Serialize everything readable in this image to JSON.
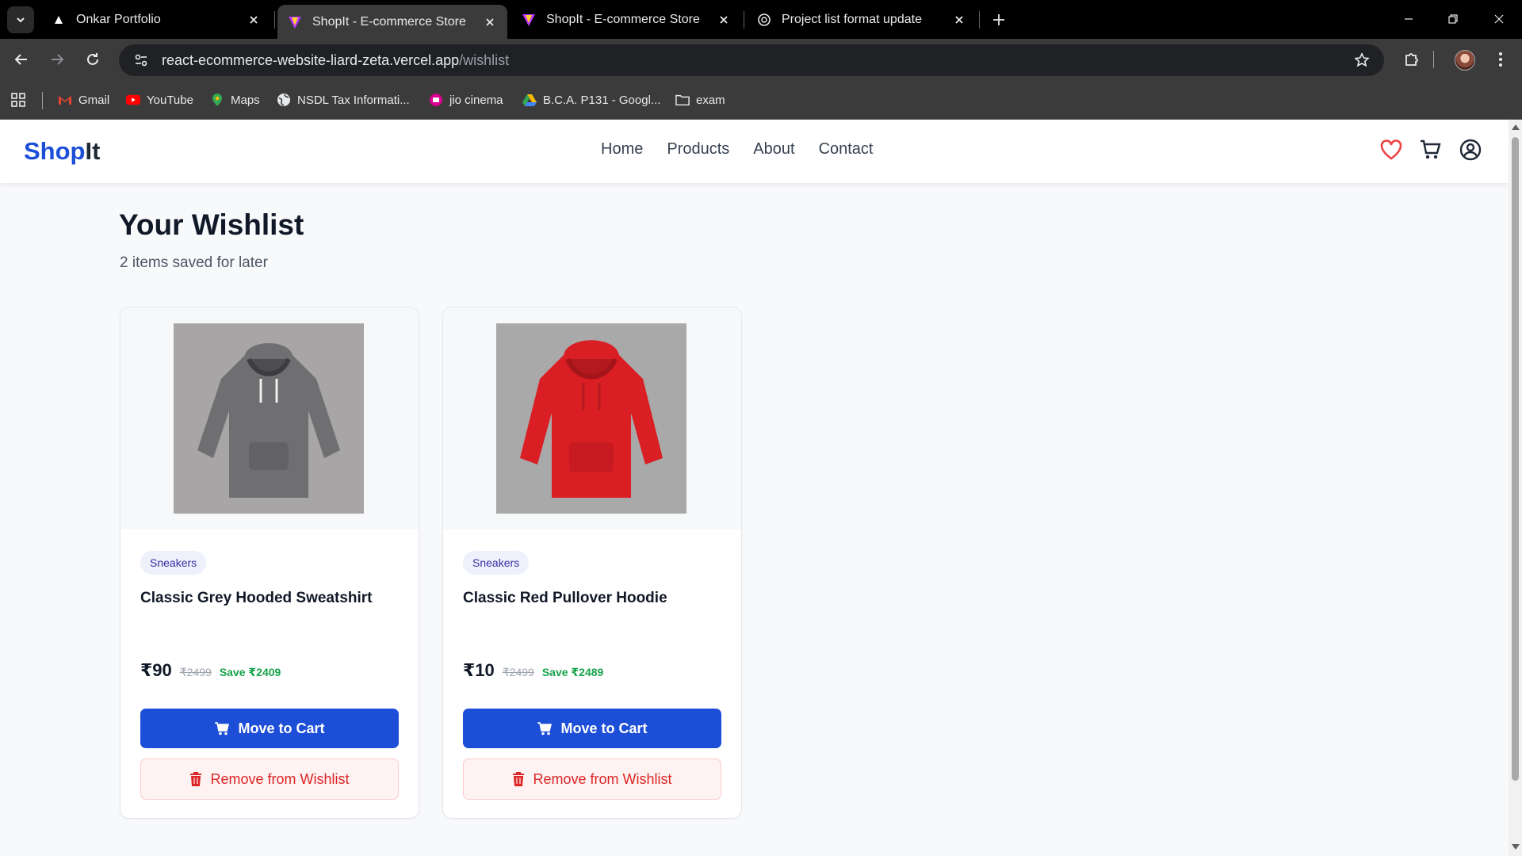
{
  "browser": {
    "tabs": [
      {
        "title": "Onkar Portfolio",
        "active": false
      },
      {
        "title": "ShopIt - E-commerce Store",
        "active": true
      },
      {
        "title": "ShopIt - E-commerce Store",
        "active": false
      },
      {
        "title": "Project list format update",
        "active": false
      }
    ],
    "url_host": "react-ecommerce-website-liard-zeta.vercel.app",
    "url_path": "/wishlist",
    "bookmarks": [
      {
        "label": "Gmail",
        "icon": "gmail-icon"
      },
      {
        "label": "YouTube",
        "icon": "youtube-icon"
      },
      {
        "label": "Maps",
        "icon": "maps-icon"
      },
      {
        "label": "NSDL Tax Informati...",
        "icon": "globe-icon"
      },
      {
        "label": "jio cinema",
        "icon": "jiocinema-icon"
      },
      {
        "label": "B.C.A. P131 - Googl...",
        "icon": "drive-icon"
      },
      {
        "label": "exam",
        "icon": "folder-icon"
      }
    ]
  },
  "site": {
    "logo_shop": "Shop",
    "logo_it": "It",
    "nav": [
      "Home",
      "Products",
      "About",
      "Contact"
    ],
    "colors": {
      "brand": "#1d4ed8",
      "danger": "#dc2626",
      "success": "#16a34a",
      "heart": "#ef4444"
    }
  },
  "wishlist": {
    "title": "Your Wishlist",
    "subtitle": "2 items saved for later",
    "items": [
      {
        "category": "Sneakers",
        "name": "Classic Grey Hooded Sweatshirt",
        "price": "₹90",
        "original_price": "₹2499",
        "savings": "Save ₹2409",
        "image_color": "#6f6f72",
        "move_label": "Move to Cart",
        "remove_label": "Remove from Wishlist"
      },
      {
        "category": "Sneakers",
        "name": "Classic Red Pullover Hoodie",
        "price": "₹10",
        "original_price": "₹2499",
        "savings": "Save ₹2489",
        "image_color": "#d91e24",
        "move_label": "Move to Cart",
        "remove_label": "Remove from Wishlist"
      }
    ]
  }
}
